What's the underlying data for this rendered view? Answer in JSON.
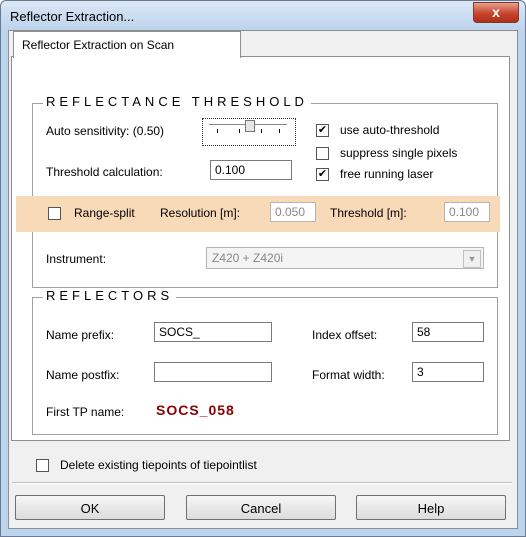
{
  "window": {
    "title": "Reflector Extraction...",
    "close": "x"
  },
  "tab": {
    "label": "Reflector Extraction on Scan"
  },
  "threshold": {
    "legend": "REFLECTANCE THRESHOLD",
    "auto_sensitivity_pre": "Auto sensitivity: (0.50)",
    "threshold_calc_label": "Threshold calculation:",
    "threshold_calc_value": "0.100",
    "use_auto_threshold": {
      "label": "use auto-threshold",
      "checked": true
    },
    "suppress_single_pixels": {
      "label": "suppress single pixels",
      "checked": false
    },
    "free_running_laser": {
      "label": "free running laser",
      "checked": true
    }
  },
  "range_split": {
    "label": "Range-split",
    "checked": false,
    "resolution_label": "Resolution [m]:",
    "resolution_value": "0.050",
    "threshold_label": "Threshold [m]:",
    "threshold_value": "0.100"
  },
  "instrument": {
    "label": "Instrument:",
    "value": "Z420 + Z420i"
  },
  "reflectors": {
    "legend": "REFLECTORS",
    "name_prefix_label": "Name prefix:",
    "name_prefix_value": "SOCS_",
    "name_postfix_label": "Name postfix:",
    "name_postfix_value": "",
    "index_offset_label": "Index offset:",
    "index_offset_value": "58",
    "format_width_label": "Format width:",
    "format_width_value": "3",
    "first_tp_label": "First TP name:",
    "first_tp_value": "SOCS_058"
  },
  "delete_tiepoints": {
    "label": "Delete existing tiepoints of tiepointlist",
    "checked": false
  },
  "buttons": {
    "ok": "OK",
    "cancel": "Cancel",
    "help": "Help"
  }
}
